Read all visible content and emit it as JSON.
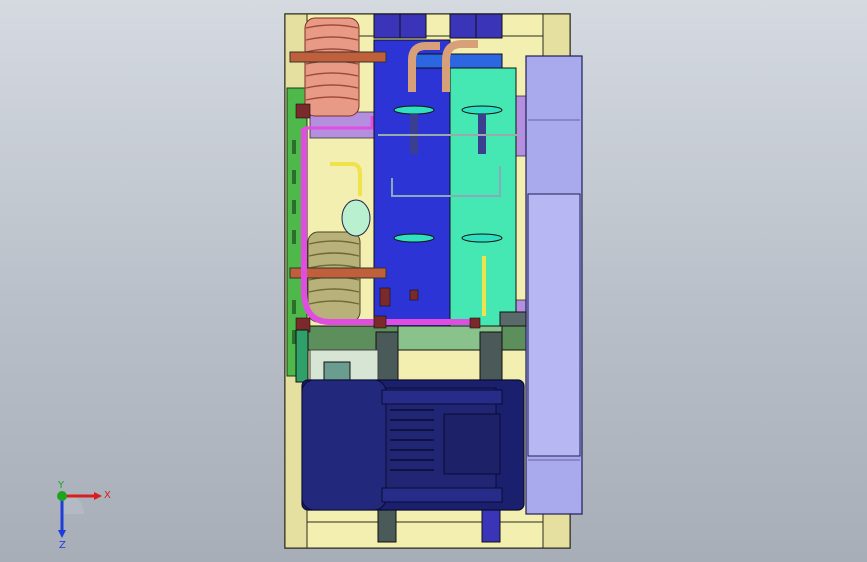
{
  "viewport": {
    "background_top": "#d5dae1",
    "background_bottom": "#a8aeb8"
  },
  "colors": {
    "frame_yellow": "#f3efb0",
    "frame_outline": "#2b2b1a",
    "panel_purple": "#b48fe0",
    "panel_blue": "#2c34d6",
    "panel_teal": "#45e8b2",
    "panel_green": "#4fb84a",
    "fan_lavender": "#a9a9ee",
    "motor_navy": "#1a1f6e",
    "coil_copper": "#e89a86",
    "coil_olive": "#b8b27a",
    "pipe_magenta": "#e04ee0",
    "pipe_yellow": "#f0e24a"
  },
  "triad": {
    "x_label": "X",
    "y_label": "Y",
    "z_label": "Z",
    "x_color": "#d81e1e",
    "y_color": "#1ea51e",
    "z_color": "#1e3cd8"
  }
}
